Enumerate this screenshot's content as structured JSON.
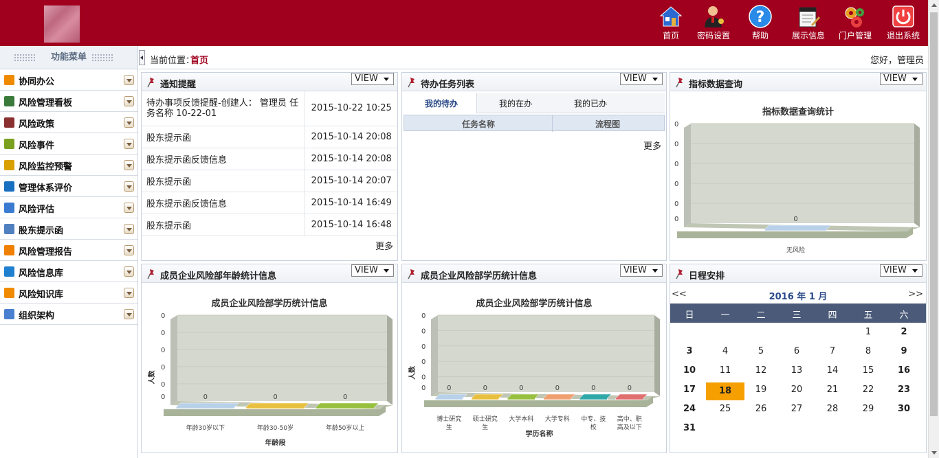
{
  "header": {
    "nav": [
      {
        "id": "home",
        "label": "首页",
        "icon": "home-icon"
      },
      {
        "id": "password",
        "label": "密码设置",
        "icon": "user-key-icon"
      },
      {
        "id": "help",
        "label": "帮助",
        "icon": "help-icon"
      },
      {
        "id": "display",
        "label": "展示信息",
        "icon": "notepad-icon"
      },
      {
        "id": "portal",
        "label": "门户管理",
        "icon": "gears-icon"
      },
      {
        "id": "logout",
        "label": "退出系统",
        "icon": "power-icon"
      }
    ],
    "colors": {
      "brand": "#a0001e"
    }
  },
  "sidebar": {
    "title": "功能菜单",
    "items": [
      {
        "label": "协同办公",
        "icon": "collab-icon",
        "color": "#f08a00"
      },
      {
        "label": "风险管理看板",
        "icon": "bar-chart-icon",
        "color": "#3a7a3a"
      },
      {
        "label": "风险政策",
        "icon": "calendar-icon",
        "color": "#8a3030"
      },
      {
        "label": "风险事件",
        "icon": "lock-icon",
        "color": "#7aa020"
      },
      {
        "label": "风险监控预警",
        "icon": "monitor-icon",
        "color": "#d8a000"
      },
      {
        "label": "管理体系评价",
        "icon": "triangle-icon",
        "color": "#1a70c0"
      },
      {
        "label": "风险评估",
        "icon": "map-icon",
        "color": "#3a7ad0"
      },
      {
        "label": "股东提示函",
        "icon": "doc-icon",
        "color": "#5080c0"
      },
      {
        "label": "风险管理报告",
        "icon": "clock-icon",
        "color": "#f08000"
      },
      {
        "label": "风险信息库",
        "icon": "database-icon",
        "color": "#2080d0"
      },
      {
        "label": "风险知识库",
        "icon": "book-icon",
        "color": "#f08a00"
      },
      {
        "label": "组织架构",
        "icon": "people-icon",
        "color": "#4a80d0"
      }
    ]
  },
  "breadcrumb": {
    "label": "当前位置：",
    "current": "首页",
    "greeting": "您好，管理员"
  },
  "panels": {
    "view_label": "VIEW",
    "notice": {
      "title": "通知提醒",
      "rows": [
        {
          "text": "待办事项反馈提醒-创建人： 管理员 任务名称 10-22-01",
          "date": "2015-10-22 10:25"
        },
        {
          "text": "股东提示函",
          "date": "2015-10-14 20:08"
        },
        {
          "text": "股东提示函反馈信息",
          "date": "2015-10-14 20:08"
        },
        {
          "text": "股东提示函",
          "date": "2015-10-14 20:07"
        },
        {
          "text": "股东提示函反馈信息",
          "date": "2015-10-14 16:49"
        },
        {
          "text": "股东提示函",
          "date": "2015-10-14 16:48"
        }
      ],
      "more": "更多"
    },
    "tasks": {
      "title": "待办任务列表",
      "tabs": [
        "我的待办",
        "我的在办",
        "我的已办"
      ],
      "columns": [
        "任务名称",
        "流程图"
      ],
      "more": "更多"
    },
    "indicator": {
      "title": "指标数据查询",
      "chart_title": "指标数据查询统计",
      "more": ""
    },
    "age": {
      "title": "成员企业风险部年龄统计信息"
    },
    "education": {
      "title": "成员企业风险部学历统计信息"
    },
    "schedule": {
      "title": "日程安排",
      "prev": "<<",
      "next": ">>",
      "month_label": "2016 年 1 月",
      "weekdays": [
        "日",
        "一",
        "二",
        "三",
        "四",
        "五",
        "六"
      ],
      "today": 18
    }
  },
  "chart_data": [
    {
      "type": "bar",
      "title": "指标数据查询统计",
      "categories": [
        "无风险"
      ],
      "values": [
        0
      ],
      "yticks": [
        "0",
        "0",
        "0",
        "0",
        "0",
        "0"
      ],
      "xlabel": "",
      "ylabel": "",
      "colors": [
        "#b8d0e8"
      ]
    },
    {
      "type": "bar",
      "title": "成员企业风险部学历统计信息",
      "categories": [
        "年龄30岁以下",
        "年龄30-50岁",
        "年龄50岁以上"
      ],
      "values": [
        0,
        0,
        0
      ],
      "yticks": [
        "0",
        "0",
        "0",
        "0",
        "0",
        "0"
      ],
      "xlabel": "年龄段",
      "ylabel": "人数",
      "colors": [
        "#b8d0e8",
        "#e8c040",
        "#98c040"
      ]
    },
    {
      "type": "bar",
      "title": "成员企业风险部学历统计信息",
      "categories": [
        "博士研究生",
        "硕士研究生",
        "大学本科",
        "大学专科",
        "中专、技校",
        "高中、职高及以下"
      ],
      "values": [
        0,
        0,
        0,
        0,
        0,
        0
      ],
      "yticks": [
        "0",
        "0",
        "0",
        "0",
        "0",
        "0"
      ],
      "xlabel": "学历名称",
      "ylabel": "人数",
      "colors": [
        "#b8d0e8",
        "#e8c040",
        "#98c040",
        "#f0a070",
        "#30a8a8",
        "#e07070"
      ]
    }
  ]
}
